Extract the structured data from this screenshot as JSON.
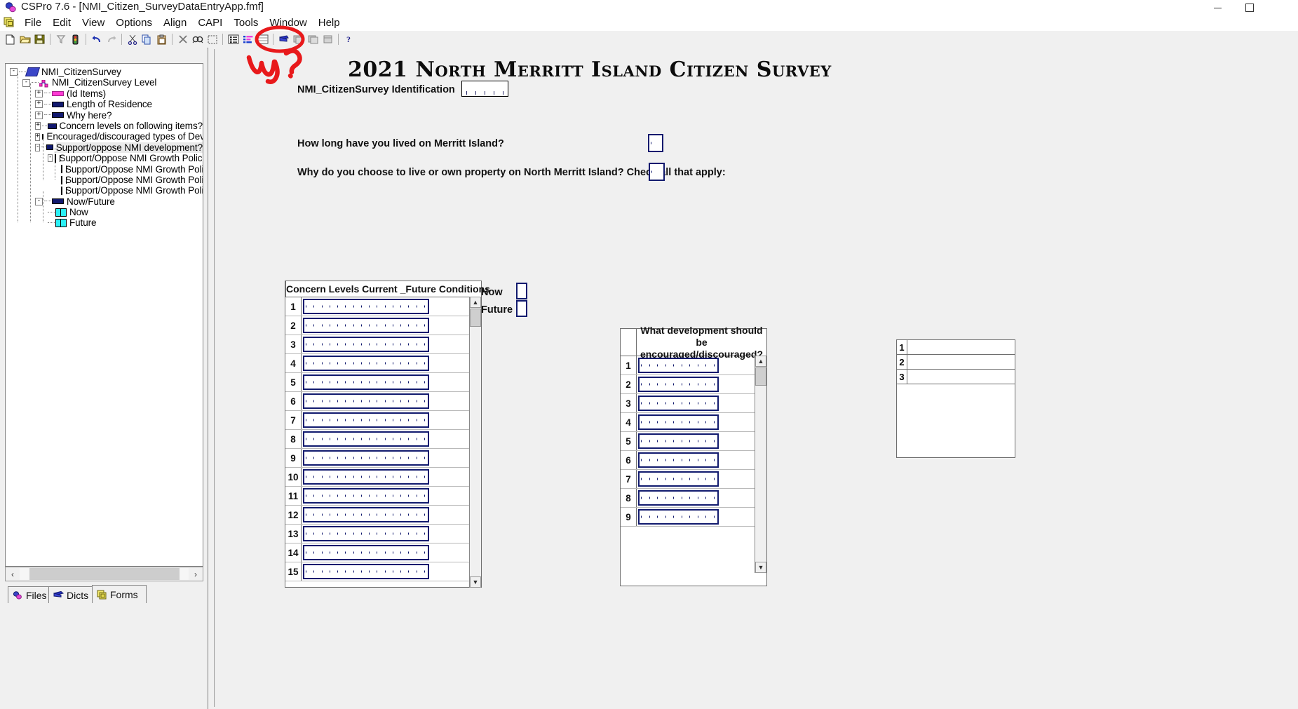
{
  "window": {
    "title": "CSPro 7.6 - [NMI_Citizen_SurveyDataEntryApp.fmf]",
    "minimize_label": "─",
    "maximize_label": "□",
    "close_label": "✕"
  },
  "menu": {
    "items": [
      "File",
      "Edit",
      "View",
      "Options",
      "Align",
      "CAPI",
      "Tools",
      "Window",
      "Help"
    ]
  },
  "toolbar": {
    "buttons": [
      "new-icon",
      "open-icon",
      "save-icon",
      "filter-icon",
      "trafficlight-icon",
      "undo-icon",
      "redo-icon",
      "cut-icon",
      "copy-icon",
      "paste-icon",
      "delete-icon",
      "find-icon",
      "select-icon",
      "align-list-icon",
      "properties-icon",
      "rows-icon",
      "dict-icon",
      "form-tile-icon",
      "form-tile2-icon",
      "form-tile3-icon",
      "help-icon"
    ]
  },
  "tree": {
    "items": [
      {
        "label": "NMI_CitizenSurvey",
        "indent": 0,
        "expander": "-",
        "icon": "book-icon"
      },
      {
        "label": "NMI_CitizenSurvey Level",
        "indent": 1,
        "expander": "-",
        "icon": "level-icon"
      },
      {
        "label": "(Id Items)",
        "indent": 2,
        "expander": "+",
        "icon": "pink-bar-icon"
      },
      {
        "label": "Length of Residence",
        "indent": 2,
        "expander": "+",
        "icon": "navy-bar-icon"
      },
      {
        "label": "Why here?",
        "indent": 2,
        "expander": "+",
        "icon": "navy-bar-icon"
      },
      {
        "label": "Concern levels on following items?",
        "indent": 2,
        "expander": "+",
        "icon": "navy-bar-icon"
      },
      {
        "label": "Encouraged/discouraged types of Develo",
        "indent": 2,
        "expander": "+",
        "icon": "navy-bar-icon"
      },
      {
        "label": "Support/oppose NMI development?",
        "indent": 2,
        "expander": "-",
        "icon": "navy-bar-icon",
        "selected": true
      },
      {
        "label": "Support/Oppose NMI Growth Policies?",
        "indent": 3,
        "expander": "-",
        "icon": "cell-icon"
      },
      {
        "label": "Support/Oppose NMI Growth Policie",
        "indent": 4,
        "expander": "",
        "icon": "cell-icon"
      },
      {
        "label": "Support/Oppose NMI Growth Policie",
        "indent": 4,
        "expander": "",
        "icon": "cell-icon"
      },
      {
        "label": "Support/Oppose NMI Growth Policie",
        "indent": 4,
        "expander": "",
        "icon": "cell-icon"
      },
      {
        "label": "Now/Future",
        "indent": 2,
        "expander": "-",
        "icon": "navy-bar-icon"
      },
      {
        "label": "Now",
        "indent": 3,
        "expander": "",
        "icon": "cell-icon"
      },
      {
        "label": "Future",
        "indent": 3,
        "expander": "",
        "icon": "cell-icon"
      }
    ],
    "hscroll": {
      "left_arrow": "‹",
      "right_arrow": "›"
    },
    "tabs": [
      {
        "label": "Files",
        "icon": "files-icon",
        "active": false
      },
      {
        "label": "Dicts",
        "icon": "dicts-icon",
        "active": false
      },
      {
        "label": "Forms",
        "icon": "forms-icon",
        "active": true
      }
    ]
  },
  "form": {
    "title": "2021 North Merritt Island Citizen Survey",
    "identification_label": "NMI_CitizenSurvey Identification",
    "question_residence": "How long have you lived on Merritt Island?",
    "question_why": "Why do you choose to live or own property on North Merritt Island?  Check all that apply:",
    "now_label": "Now",
    "future_label": "Future",
    "concern_roster": {
      "header": "Concern Levels Current _Future Conditions",
      "rows": [
        "1",
        "2",
        "3",
        "4",
        "5",
        "6",
        "7",
        "8",
        "9",
        "10",
        "11",
        "12",
        "13",
        "14",
        "15"
      ]
    },
    "development_roster": {
      "header": "What development should be encouraged/discouraged?",
      "rows": [
        "1",
        "2",
        "3",
        "4",
        "5",
        "6",
        "7",
        "8",
        "9"
      ]
    },
    "third_roster": {
      "rows": [
        "1",
        "2",
        "3"
      ]
    },
    "scroll": {
      "up_arrow": "▲",
      "down_arrow": "▼"
    }
  },
  "annotation": {
    "text": "why?",
    "color": "#e8191b"
  },
  "colors": {
    "field_border_navy": "#111a6e",
    "window_bg": "#f0f0f0",
    "tree_bg": "#ffffff"
  }
}
